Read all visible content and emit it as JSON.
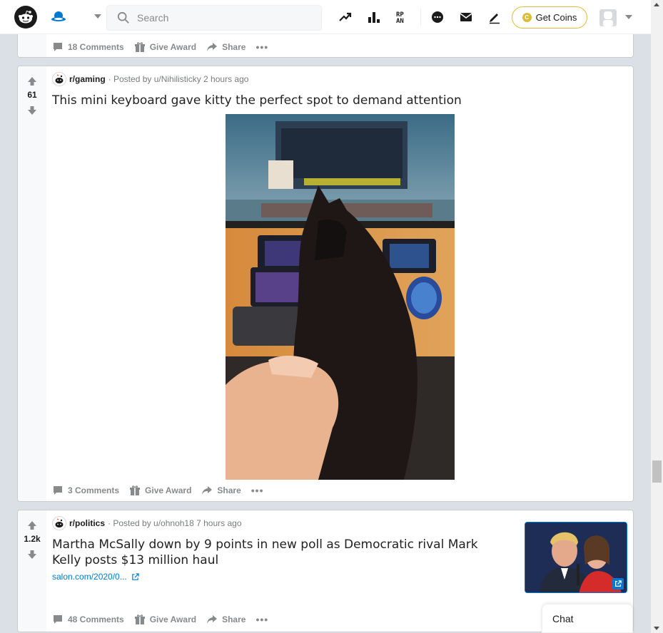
{
  "header": {
    "search_placeholder": "Search",
    "get_coins_label": "Get Coins"
  },
  "posts": [
    {
      "comments": "18 Comments",
      "award": "Give Award",
      "share": "Share"
    },
    {
      "score": "61",
      "subreddit": "r/gaming",
      "posted_by": "· Posted by u/Nihilisticky 2 hours ago",
      "title": "This mini keyboard gave kitty the perfect spot to demand attention",
      "comments": "3 Comments",
      "award": "Give Award",
      "share": "Share"
    },
    {
      "score": "1.2k",
      "subreddit": "r/politics",
      "posted_by": "· Posted by u/ohnoh18 7 hours ago",
      "title": "Martha McSally down by 9 points in new poll as Democratic rival Mark Kelly posts $13 million haul",
      "link": "salon.com/2020/0...",
      "comments": "48 Comments",
      "award": "Give Award",
      "share": "Share"
    }
  ],
  "chat": {
    "label": "Chat"
  },
  "colors": {
    "accent": "#0079d3",
    "coins_border": "#ddbd37",
    "page_bg": "#dae0e6"
  },
  "icons": [
    "reddit-logo-icon",
    "home-icon",
    "search-icon",
    "trending-icon",
    "leaderboard-icon",
    "rpan-icon",
    "chat-icon",
    "mail-icon",
    "pencil-icon",
    "coin-icon",
    "avatar-icon",
    "upvote-icon",
    "downvote-icon",
    "comment-icon",
    "gift-icon",
    "share-icon",
    "more-icon",
    "external-link-icon"
  ]
}
